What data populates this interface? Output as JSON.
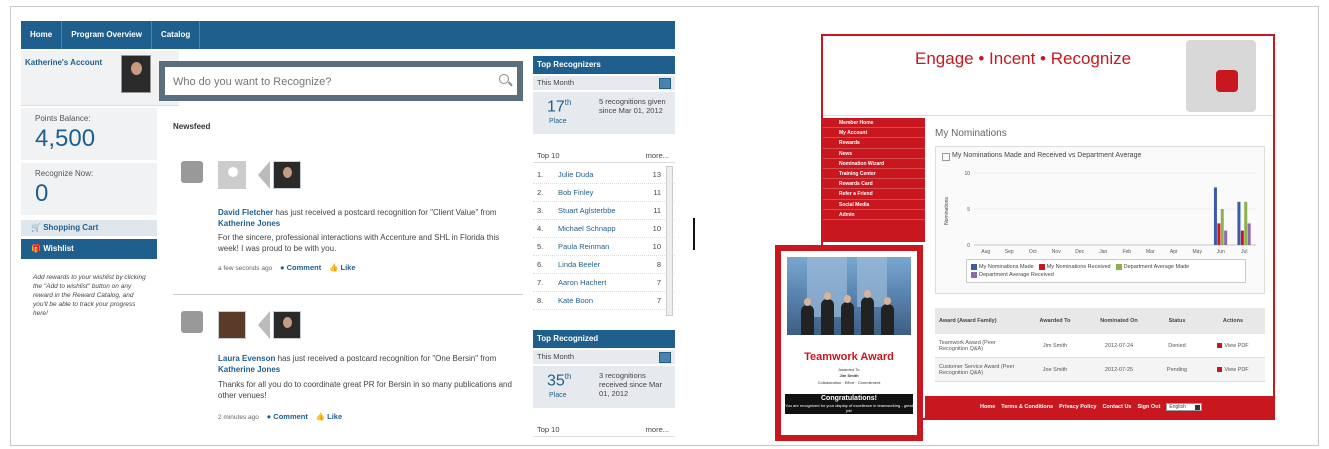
{
  "left_app": {
    "nav": [
      "Home",
      "Program Overview",
      "Catalog"
    ],
    "account_title": "Katherine's Account",
    "points_label": "Points Balance:",
    "points_value": "4,500",
    "recognize_label": "Recognize Now:",
    "recognize_value": "0",
    "shopping_cart": "Shopping Cart",
    "wishlist": "Wishlist",
    "wishlist_text": "Add rewards to your wishlist by clicking the \"Add to wishlist\" button on any reward in the Reward Catalog, and you'll be able to track your progress here!",
    "search_placeholder": "Who do you want to Recognize?",
    "newsfeed_title": "Newsfeed",
    "feed": [
      {
        "recipient": "David Fletcher",
        "text": "has just received a postcard recognition for \"Client Value\" from",
        "giver": "Katherine Jones",
        "message": "For the sincere, professional interactions with Accenture and SHL in Florida this week! I was proud to be with you.",
        "time": "a few seconds ago",
        "comment": "Comment",
        "like": "Like"
      },
      {
        "recipient": "Laura Evenson",
        "text": "has just received a postcard recognition for \"One Bersin\" from",
        "giver": "Katherine Jones",
        "message": "Thanks for all you do to coordinate great PR for Bersin in so many publications and other venues!",
        "time": "2 minutes ago",
        "comment": "Comment",
        "like": "Like"
      }
    ],
    "top_recognizers": {
      "title": "Top Recognizers",
      "period": "This Month",
      "place_num": "17",
      "place_suffix": "th",
      "place_label": "Place",
      "desc": "5 recognitions given since Mar 01, 2012",
      "top10_label": "Top 10",
      "more": "more...",
      "list": [
        {
          "n": "1.",
          "name": "Julie Duda",
          "count": "13"
        },
        {
          "n": "2.",
          "name": "Bob Finley",
          "count": "11"
        },
        {
          "n": "3.",
          "name": "Stuart Aglsterbbe",
          "count": "11"
        },
        {
          "n": "4.",
          "name": "Michael Schnapp",
          "count": "10"
        },
        {
          "n": "5.",
          "name": "Paula Reinman",
          "count": "10"
        },
        {
          "n": "6.",
          "name": "Linda Beeler",
          "count": "8"
        },
        {
          "n": "7.",
          "name": "Aaron Hachert",
          "count": "7"
        },
        {
          "n": "8.",
          "name": "Kate Boon",
          "count": "7"
        }
      ]
    },
    "top_recognized": {
      "title": "Top Recognized",
      "period": "This Month",
      "place_num": "35",
      "place_suffix": "th",
      "place_label": "Place",
      "desc": "3 recognitions received since Mar 01, 2012",
      "top10_label": "Top 10",
      "more": "more..."
    }
  },
  "right_app": {
    "title": "Engage • Incent • Recognize",
    "nav": [
      "Member Home",
      "My Account",
      "Rewards",
      "News",
      "Nomination Wizard",
      "Training Center",
      "Rewards Card",
      "Refer a Friend",
      "Social Media",
      "Admin"
    ],
    "section_title": "My Nominations",
    "chart_title": "My Nominations Made and Received vs Department Average",
    "table_headers": [
      "Award (Award Family)",
      "Awarded To",
      "Nominated On",
      "Status",
      "Actions"
    ],
    "table_rows": [
      {
        "award": "Teamwork Award (Peer Recognition Q&A)",
        "to": "Jim Smith",
        "on": "2012-07-24",
        "status": "Denied",
        "action": "View PDF"
      },
      {
        "award": "Customer Service Award (Peer Recognition Q&A)",
        "to": "Joe Smith",
        "on": "2012-07-25",
        "status": "Pending",
        "action": "View PDF"
      }
    ],
    "footer": [
      "Home",
      "Terms & Conditions",
      "Privacy Policy",
      "Contact Us",
      "Sign Out"
    ],
    "language": "English"
  },
  "award_card": {
    "title": "Teamwork Award",
    "awarded_to": "Awarded To",
    "name": "Jim Smith",
    "values": "Collaboration · Effort · Commitment",
    "congrats": "Congratulations!",
    "congrats_sub": "You are recognized for your display of excellence in teamworking - great job!"
  },
  "chart_data": {
    "type": "bar",
    "title": "My Nominations Made and Received vs Department Average",
    "ylabel": "Nominations",
    "categories": [
      "Aug",
      "Sep",
      "Oct",
      "Nov",
      "Dec",
      "Jan",
      "Feb",
      "Mar",
      "Apr",
      "May",
      "Jun",
      "Jul"
    ],
    "ylim": [
      0,
      10
    ],
    "yticks": [
      0,
      5,
      10
    ],
    "series": [
      {
        "name": "My Nominations Made",
        "color": "#3e5ba6",
        "values": [
          0,
          0,
          0,
          0,
          0,
          0,
          0,
          0,
          0,
          0,
          8,
          6
        ]
      },
      {
        "name": "My Nominations Received",
        "color": "#c8171e",
        "values": [
          0,
          0,
          0,
          0,
          0,
          0,
          0,
          0,
          0,
          0,
          3,
          2
        ]
      },
      {
        "name": "Department Average Made",
        "color": "#8db04a",
        "values": [
          0,
          0,
          0,
          0,
          0,
          0,
          0,
          0,
          0,
          0,
          5,
          6
        ]
      },
      {
        "name": "Department Average Received",
        "color": "#8a6bb0",
        "values": [
          0,
          0,
          0,
          0,
          0,
          0,
          0,
          0,
          0,
          0,
          2,
          3
        ]
      }
    ],
    "legend": "bottom"
  }
}
